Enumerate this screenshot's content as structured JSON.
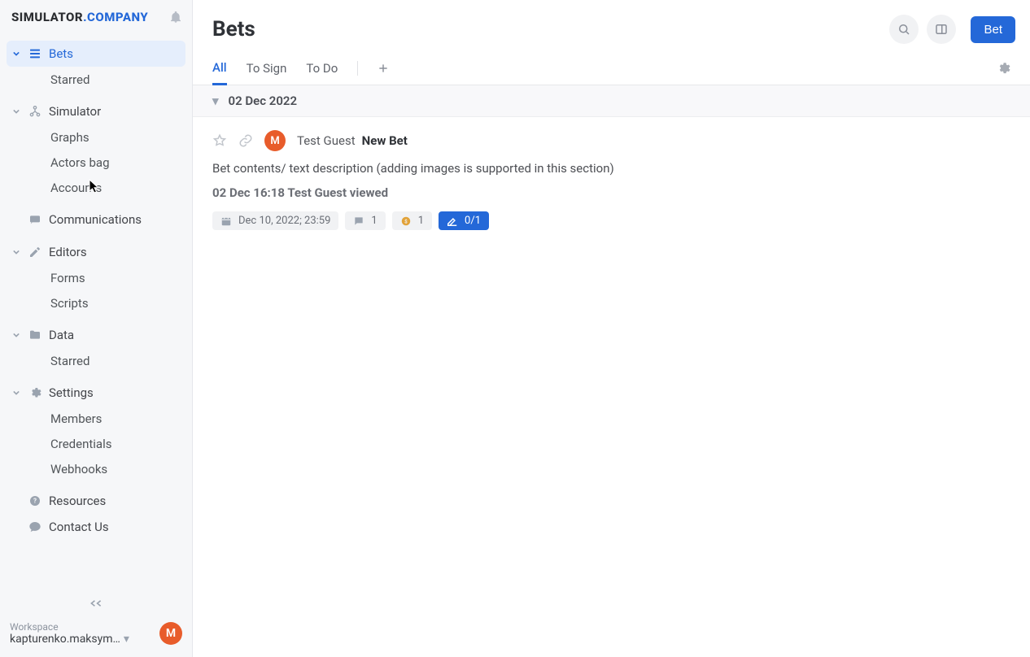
{
  "brand": {
    "primary": "SIMULATOR",
    "secondary": ".COMPANY"
  },
  "sidebar": {
    "sections": [
      {
        "name": "bets",
        "label": "Bets",
        "icon": "stream",
        "active": true,
        "expanded": true,
        "children": [
          {
            "label": "Starred"
          }
        ]
      },
      {
        "name": "simulator",
        "label": "Simulator",
        "icon": "nodes",
        "expanded": true,
        "children": [
          {
            "label": "Graphs"
          },
          {
            "label": "Actors bag"
          },
          {
            "label": "Accounts"
          }
        ]
      },
      {
        "name": "communications",
        "label": "Communications",
        "icon": "chat"
      },
      {
        "name": "editors",
        "label": "Editors",
        "icon": "pencil",
        "expanded": true,
        "children": [
          {
            "label": "Forms"
          },
          {
            "label": "Scripts"
          }
        ]
      },
      {
        "name": "data",
        "label": "Data",
        "icon": "folder",
        "expanded": true,
        "children": [
          {
            "label": "Starred"
          }
        ]
      },
      {
        "name": "settings",
        "label": "Settings",
        "icon": "gear",
        "expanded": true,
        "children": [
          {
            "label": "Members"
          },
          {
            "label": "Credentials"
          },
          {
            "label": "Webhooks"
          }
        ]
      },
      {
        "name": "resources",
        "label": "Resources",
        "icon": "help"
      },
      {
        "name": "contact",
        "label": "Contact Us",
        "icon": "speech"
      }
    ]
  },
  "workspace": {
    "label": "Workspace",
    "value": "kapturenko.maksym…",
    "avatar": "M"
  },
  "header": {
    "title": "Bets",
    "bet_button": "Bet"
  },
  "tabs": [
    {
      "label": "All",
      "active": true
    },
    {
      "label": "To Sign"
    },
    {
      "label": "To Do"
    }
  ],
  "group": {
    "date": "02 Dec 2022"
  },
  "bet": {
    "avatar": "M",
    "author": "Test Guest",
    "title": "New Bet",
    "description": "Bet contents/ text description (adding images is supported in this section)",
    "activity": "02 Dec 16:18 Test Guest viewed",
    "chips": {
      "due": "Dec 10, 2022; 23:59",
      "comments": "1",
      "coins": "1",
      "sign": "0/1"
    }
  }
}
